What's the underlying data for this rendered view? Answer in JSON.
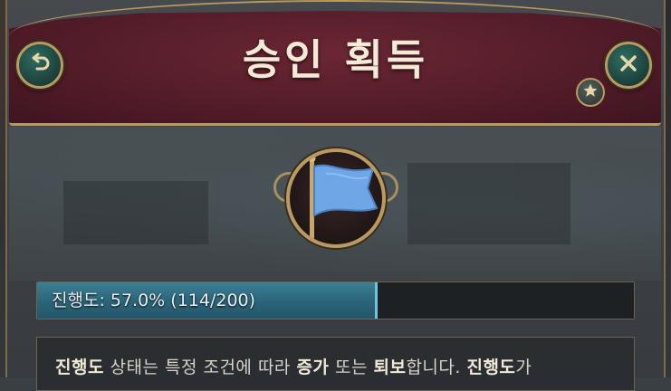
{
  "header": {
    "title": "승인 획득"
  },
  "buttons": {
    "back": "back-arrow-icon",
    "close": "close-x-icon",
    "star": "star-icon"
  },
  "emblem": {
    "icon": "blue-flag-icon",
    "flag_color": "#6fa6e6"
  },
  "progress": {
    "label": "진행도: 57.0% (114/200)",
    "fraction": 0.57,
    "fill_color": "#2b6479"
  },
  "description": {
    "segments": [
      {
        "text": "진행도",
        "bold": true
      },
      {
        "text": " 상태는 특정 조건에 따라 ",
        "bold": false
      },
      {
        "text": "증가",
        "bold": true
      },
      {
        "text": " 또는 ",
        "bold": false
      },
      {
        "text": "퇴보",
        "bold": true
      },
      {
        "text": "합니다. ",
        "bold": false
      },
      {
        "text": "진행도",
        "bold": true
      },
      {
        "text": "가",
        "bold": false
      }
    ]
  }
}
